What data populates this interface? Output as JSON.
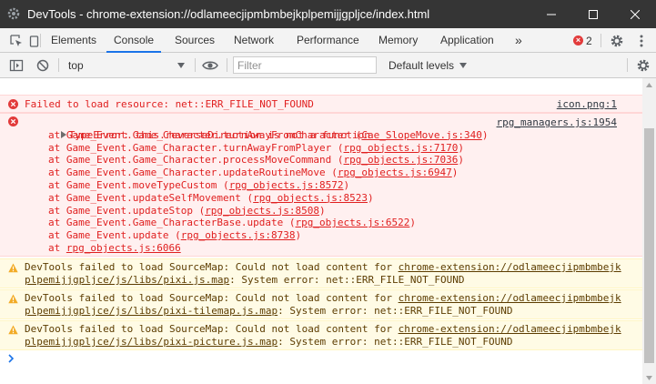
{
  "window": {
    "title": "DevTools - chrome-extension://odlameecjipmbmbejkplpemijjgpljce/index.html"
  },
  "tabs": [
    {
      "label": "Elements"
    },
    {
      "label": "Console",
      "active": true
    },
    {
      "label": "Sources"
    },
    {
      "label": "Network"
    },
    {
      "label": "Performance"
    },
    {
      "label": "Memory"
    },
    {
      "label": "Application"
    }
  ],
  "tabbar": {
    "more_label": "»",
    "error_count": "2"
  },
  "toolbar": {
    "context_value": "top",
    "filter_placeholder": "Filter",
    "levels_label": "Default levels"
  },
  "messages": {
    "err1": {
      "text": "Failed to load resource: net::ERR_FILE_NOT_FOUND",
      "source": "icon.png:1"
    },
    "err2": {
      "head": "TypeError: this.reverseDirection is not a function",
      "source": "rpg_managers.js:1954",
      "stack": [
        {
          "fn": "at Game_Event.Game_Character.turnAwayFromCharacter (",
          "file": "Cae_SlopeMove.js:340",
          "end": ")"
        },
        {
          "fn": "at Game_Event.Game_Character.turnAwayFromPlayer (",
          "file": "rpg_objects.js:7170",
          "end": ")"
        },
        {
          "fn": "at Game_Event.Game_Character.processMoveCommand (",
          "file": "rpg_objects.js:7036",
          "end": ")"
        },
        {
          "fn": "at Game_Event.Game_Character.updateRoutineMove (",
          "file": "rpg_objects.js:6947",
          "end": ")"
        },
        {
          "fn": "at Game_Event.moveTypeCustom (",
          "file": "rpg_objects.js:8572",
          "end": ")"
        },
        {
          "fn": "at Game_Event.updateSelfMovement (",
          "file": "rpg_objects.js:8523",
          "end": ")"
        },
        {
          "fn": "at Game_Event.updateStop (",
          "file": "rpg_objects.js:8508",
          "end": ")"
        },
        {
          "fn": "at Game_Event.Game_CharacterBase.update (",
          "file": "rpg_objects.js:6522",
          "end": ")"
        },
        {
          "fn": "at Game_Event.update (",
          "file": "rpg_objects.js:8738",
          "end": ")"
        },
        {
          "fn": "at ",
          "file": "rpg_objects.js:6066",
          "end": ""
        }
      ]
    },
    "warnings": [
      {
        "prefix": "DevTools failed to load SourceMap: Could not load content for ",
        "url1": "chrome-extension://odlameecjipmbmbejk",
        "url2": "plpemijjgpljce/js/libs/pixi.js.map",
        "suffix": ": System error: net::ERR_FILE_NOT_FOUND"
      },
      {
        "prefix": "DevTools failed to load SourceMap: Could not load content for ",
        "url1": "chrome-extension://odlameecjipmbmbejk",
        "url2": "plpemijjgpljce/js/libs/pixi-tilemap.js.map",
        "suffix": ": System error: net::ERR_FILE_NOT_FOUND"
      },
      {
        "prefix": "DevTools failed to load SourceMap: Could not load content for ",
        "url1": "chrome-extension://odlameecjipmbmbejk",
        "url2": "plpemijjgpljce/js/libs/pixi-picture.js.map",
        "suffix": ": System error: net::ERR_FILE_NOT_FOUND"
      }
    ]
  },
  "colors": {
    "titlebar": "#353535",
    "accent": "#1a73e8",
    "error_text": "#e02020",
    "error_bg": "#fff0f0",
    "warning_bg": "#fffbe5"
  }
}
